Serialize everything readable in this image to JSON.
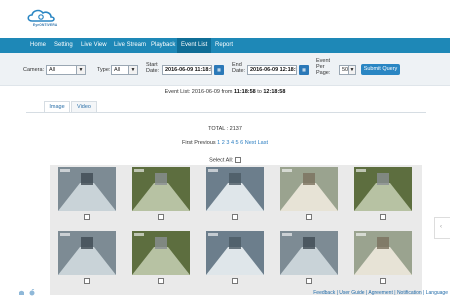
{
  "brand": {
    "logo_text": "EyeONTIVERA"
  },
  "nav": {
    "items": [
      "Home",
      "Setting",
      "Live View",
      "Live Stream",
      "Playback",
      "Event List",
      "Report"
    ],
    "active": "Event List"
  },
  "filters": {
    "camera_label": "Camera:",
    "camera_value": "All",
    "type_label": "Type:",
    "type_value": "All",
    "start_label": "Start Date:",
    "start_value": "2016-06-09 11:18:5",
    "end_label": "End Date:",
    "end_value": "2016-06-09 12:18:5",
    "per_page_label": "Event Per Page:",
    "per_page_value": "50",
    "submit_label": "Submit Query"
  },
  "event_list": {
    "prefix": "Event List: 2016-06-09 from",
    "from_time": "11:18:58",
    "to_word": "to",
    "to_time": "12:18:58"
  },
  "tabs": [
    "Image",
    "Video"
  ],
  "total": "TOTAL : 2137",
  "pager": {
    "first": "First",
    "previous": "Previous",
    "pages": [
      "1",
      "2",
      "3",
      "4",
      "5",
      "6"
    ],
    "next": "Next",
    "last": "Last"
  },
  "select_all_label": "Select All:",
  "thumbnails": [
    {
      "scene": "hall"
    },
    {
      "scene": "corridor"
    },
    {
      "scene": "indoor"
    },
    {
      "scene": "room"
    },
    {
      "scene": "corridor"
    },
    {
      "scene": "hall"
    },
    {
      "scene": "corridor"
    },
    {
      "scene": "indoor"
    },
    {
      "scene": "hall"
    },
    {
      "scene": "room"
    }
  ],
  "footer": {
    "links": [
      "Feedback",
      "User Guide",
      "Agreement",
      "Notification",
      "Language"
    ]
  },
  "colors": {
    "navbar": "#1e88b7",
    "accent": "#2a86c3",
    "link": "#2a7dc1"
  }
}
